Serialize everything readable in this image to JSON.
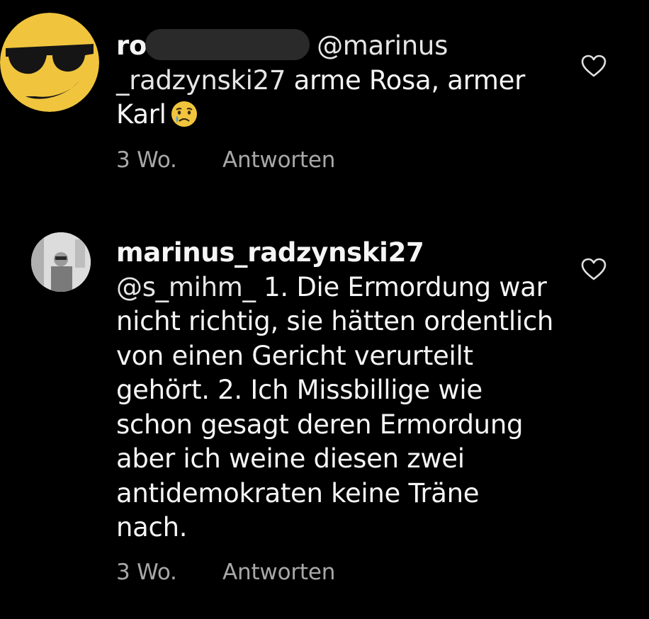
{
  "comments": [
    {
      "username": "ro",
      "mention": "@marinus _radzynski27",
      "text": "arme Rosa, armer Karl",
      "emoji": "crying-face-emoji",
      "time": "3 Wo.",
      "reply_label": "Antworten"
    },
    {
      "username": "marinus_radzynski27",
      "mention": "@s_mihm_",
      "text": "1. Die Ermordung war nicht richtig, sie hätten ordentlich von einen Gericht verurteilt gehört. 2. Ich Missbillige wie schon gesagt deren Ermordung aber ich weine diesen zwei antidemokraten keine Träne nach.",
      "time": "3 Wo.",
      "reply_label": "Antworten"
    }
  ],
  "colors": {
    "background": "#000000",
    "text": "#f5f5f5",
    "secondary": "#a8a8a8",
    "redaction": "#2a2a2a"
  }
}
